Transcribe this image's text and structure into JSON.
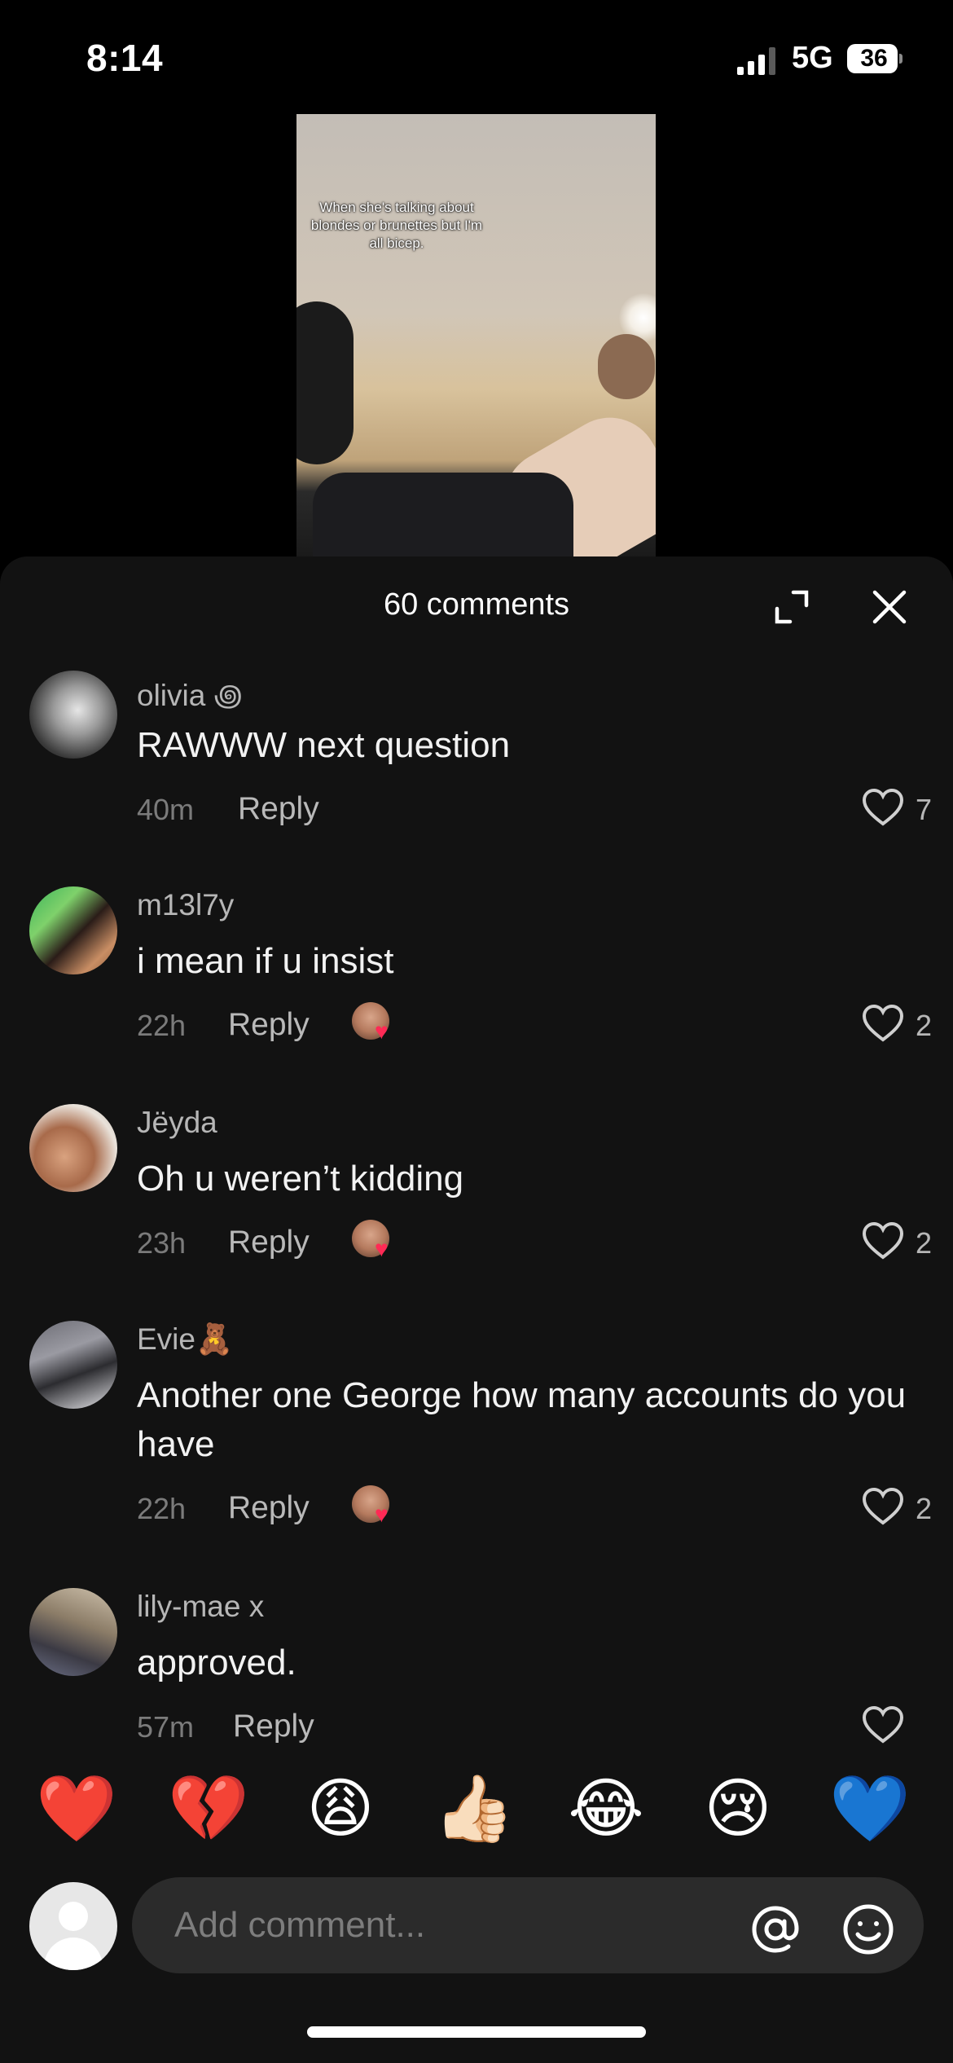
{
  "status_bar": {
    "time": "8:14",
    "network": "5G",
    "battery": "36"
  },
  "video": {
    "overlay_text": "When she's talking about blondes or brunettes but I'm all bicep."
  },
  "sheet": {
    "title": "60 comments"
  },
  "comments": [
    {
      "username": "olivia ꩜",
      "text": "RAWWW next question",
      "time": "40m",
      "reply": "Reply",
      "likes": "7",
      "creator_liked": false
    },
    {
      "username": "m13l7y",
      "text": "i mean if u insist",
      "time": "22h",
      "reply": "Reply",
      "likes": "2",
      "creator_liked": true
    },
    {
      "username": "Jëyda",
      "text": "Oh u weren’t kidding",
      "time": "23h",
      "reply": "Reply",
      "likes": "2",
      "creator_liked": true
    },
    {
      "username": "Evie🧸",
      "text": "Another one George how many accounts do you have",
      "time": "22h",
      "reply": "Reply",
      "likes": "2",
      "creator_liked": true
    },
    {
      "username": "lily-mae x",
      "text": "approved.",
      "time": "57m",
      "reply": "Reply",
      "likes": "",
      "creator_liked": false
    }
  ],
  "emoji_bar": [
    "❤️",
    "💔",
    "😩",
    "👍🏻",
    "😂",
    "😢",
    "💙"
  ],
  "input": {
    "placeholder": "Add comment..."
  },
  "icons": {
    "expand": "expand-icon",
    "close": "close-icon",
    "like": "heart-outline-icon",
    "dislike": "thumbs-down-icon",
    "mention": "at-icon",
    "emoji": "smile-icon"
  },
  "colors": {
    "background": "#000000",
    "sheet": "#121212",
    "field": "#2b2b2b",
    "creator_heart": "#ff2a55"
  }
}
